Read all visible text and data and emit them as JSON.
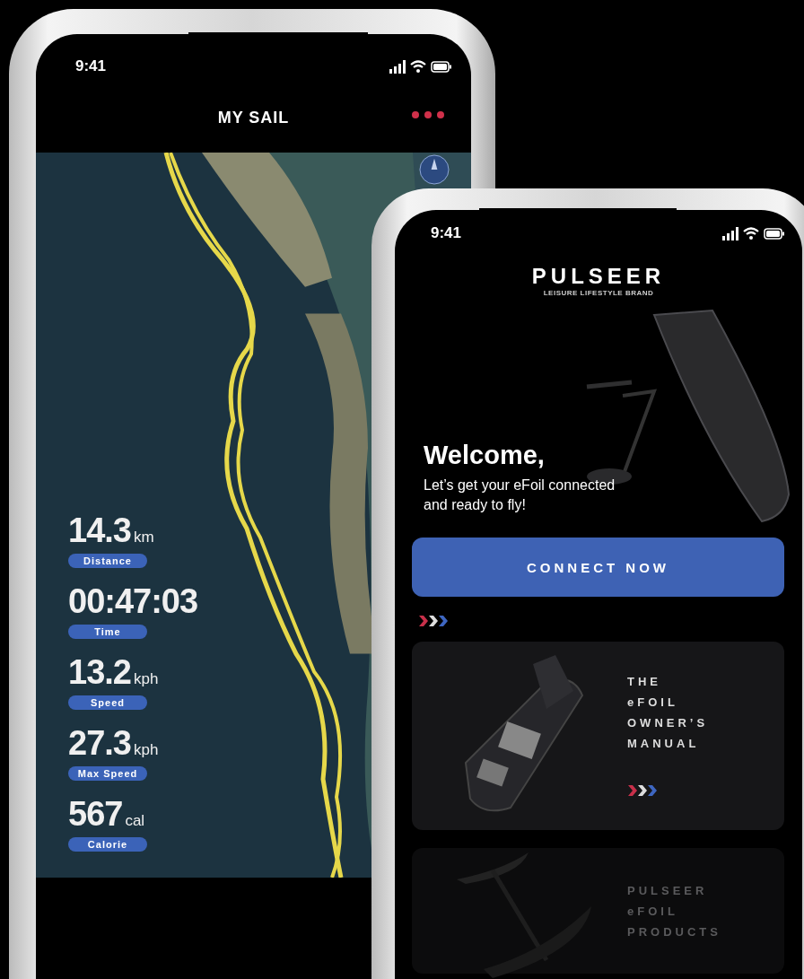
{
  "sail_phone": {
    "status_bar": {
      "time": "9:41"
    },
    "header": {
      "title": "MY SAIL"
    },
    "stats": [
      {
        "value": "14.3",
        "unit": "km",
        "label": "Distance"
      },
      {
        "value": "00:47:03",
        "label": "Time"
      },
      {
        "value": "13.2",
        "unit": "kph",
        "label": "Speed"
      },
      {
        "value": "27.3",
        "unit": "kph",
        "label": "Max Speed"
      },
      {
        "value": "567",
        "unit": "cal",
        "label": "Calorie"
      }
    ]
  },
  "home_phone": {
    "status_bar": {
      "time": "9:41"
    },
    "logo": {
      "name": "PULSEER",
      "tagline": "LEISURE LIFESTYLE BRAND"
    },
    "welcome": {
      "title": "Welcome,",
      "subtitle": "Let’s get your eFoil connected\nand ready to fly!"
    },
    "connect_button": "CONNECT NOW",
    "cards": [
      {
        "lines": [
          "THE",
          "eFOIL",
          "OWNER’S",
          "MANUAL"
        ],
        "dimmed": false
      },
      {
        "lines": [
          "PULSEER",
          "eFOIL",
          "PRODUCTS"
        ],
        "dimmed": true
      }
    ]
  }
}
